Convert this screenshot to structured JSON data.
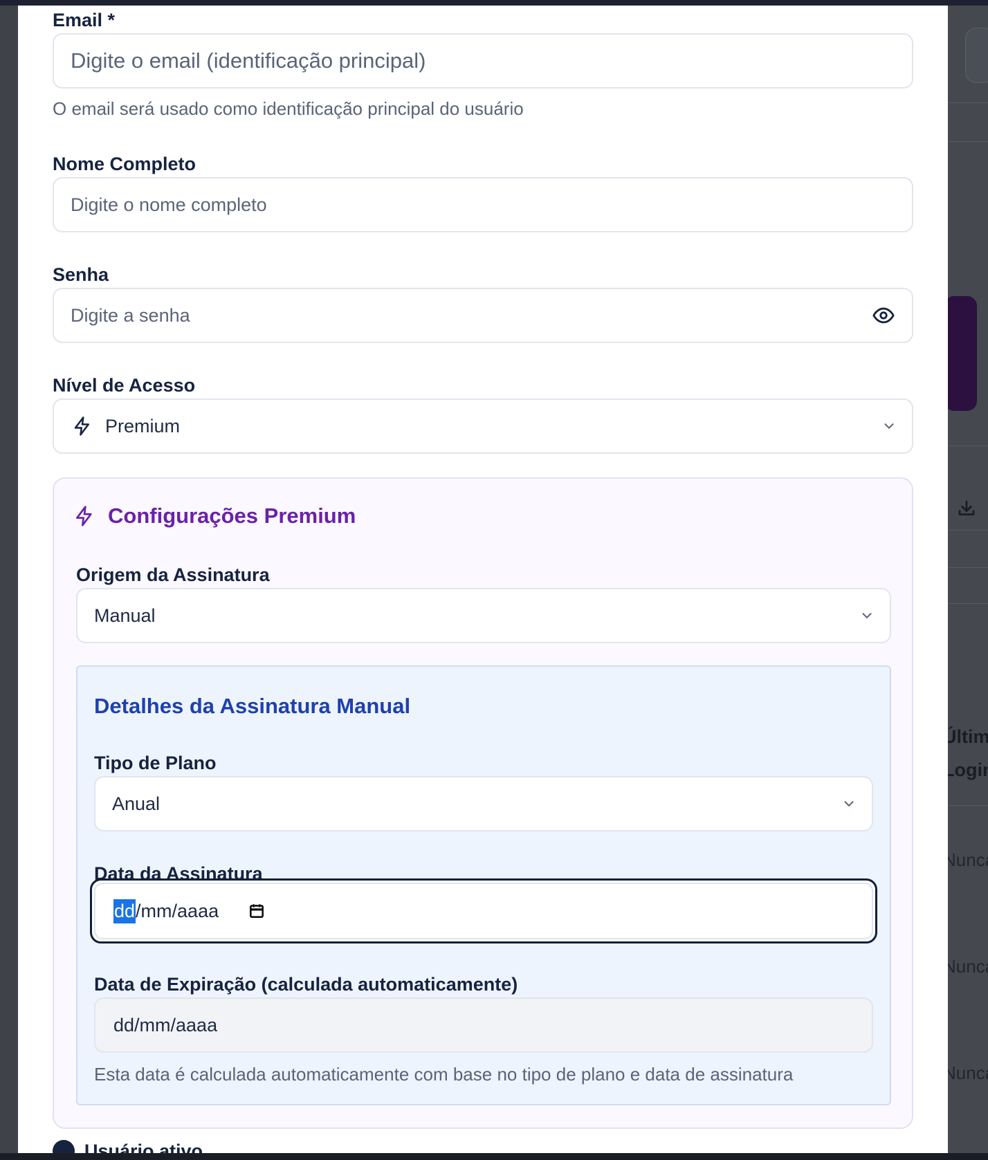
{
  "form": {
    "email": {
      "label": "Email *",
      "placeholder": "Digite o email (identificação principal)",
      "helper": "O email será usado como identificação principal do usuário"
    },
    "full_name": {
      "label": "Nome Completo",
      "placeholder": "Digite o nome completo"
    },
    "password": {
      "label": "Senha",
      "placeholder": "Digite a senha",
      "toggle_icon": "eye-icon"
    },
    "access_level": {
      "label": "Nível de Acesso",
      "value": "Premium",
      "icon": "lightning-icon"
    }
  },
  "premium": {
    "title": "Configurações Premium",
    "icon": "lightning-icon",
    "origin": {
      "label": "Origem da Assinatura",
      "value": "Manual"
    },
    "manual": {
      "title": "Detalhes da Assinatura Manual",
      "plan_type": {
        "label": "Tipo de Plano",
        "value": "Anual"
      },
      "subscription_date": {
        "label": "Data da Assinatura",
        "seg_day": "dd",
        "seg_rest": "/mm/aaaa"
      },
      "expiration_date": {
        "label": "Data de Expiração (calculada automaticamente)",
        "value": "dd/mm/aaaa",
        "helper": "Esta data é calculada automaticamente com base no tipo de plano e data de assinatura"
      }
    }
  },
  "background": {
    "texts": [
      "Últim",
      "Login",
      "Nunca",
      "Nunca",
      "Nunca"
    ]
  },
  "bottom_peek": "Usuário ativo",
  "colors": {
    "premium_accent": "#6b21a8",
    "manual_accent": "#1e40af",
    "focus_ring": "#0f1f3a",
    "selection": "#1a73e8"
  }
}
